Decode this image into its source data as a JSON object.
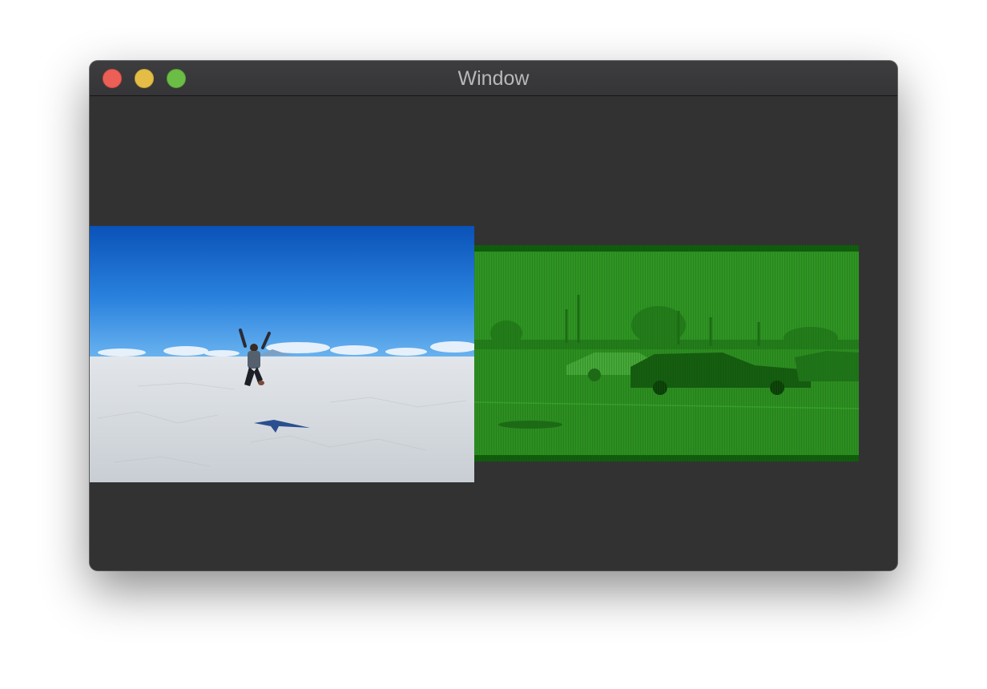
{
  "window": {
    "title": "Window"
  },
  "controls": {
    "close_color": "#ec5f57",
    "minimize_color": "#e3bd45",
    "zoom_color": "#6cbd45"
  },
  "images": {
    "left_icon": "salt-flat-jump-photo",
    "right_icon": "green-street-video-frame"
  }
}
